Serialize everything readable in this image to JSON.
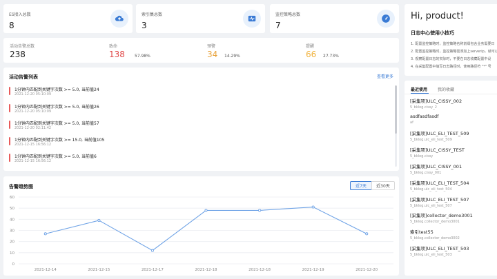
{
  "stats": [
    {
      "label": "ES接入总数",
      "value": "8",
      "icon": "upload-cloud-icon"
    },
    {
      "label": "索引集总数",
      "value": "3",
      "icon": "monitor-wave-icon"
    },
    {
      "label": "监控策略总数",
      "value": "7",
      "icon": "gauge-icon"
    }
  ],
  "summary": {
    "total_label": "活动告警总数",
    "total_value": "238",
    "fatal_label": "致命",
    "fatal_value": "138",
    "fatal_pct": "57.98%",
    "fatal_color": "#e04848",
    "warn_label": "预警",
    "warn_value": "34",
    "warn_pct": "14.29%",
    "warn_color": "#e8a23a",
    "remind_label": "提醒",
    "remind_value": "66",
    "remind_pct": "27.73%",
    "remind_color": "#f0b23c"
  },
  "alarms": {
    "title": "活动告警列表",
    "more": "查看更多",
    "items": [
      {
        "text": "1分钟内匹配到关键字次数 >= 5.0, 当前值24",
        "time": "2021-12-20 05:10:09"
      },
      {
        "text": "1分钟内匹配到关键字次数 >= 5.0, 当前值26",
        "time": "2021-12-20 05:10:09"
      },
      {
        "text": "1分钟内匹配到关键字次数 >= 5.0, 当前值57",
        "time": "2021-12-20 02:11:42"
      },
      {
        "text": "1分钟内匹配到关键字次数 >= 15.0, 当前值105",
        "time": "2021-12-15 16:56:12"
      },
      {
        "text": "1分钟内匹配到关键字次数 >= 5.0, 当前值6",
        "time": "2021-12-15 16:56:12"
      }
    ]
  },
  "trend": {
    "title": "告警趋势图",
    "btn7": "近7天",
    "btn30": "近30天"
  },
  "chart_data": {
    "type": "line",
    "categories": [
      "2021-12-14",
      "2021-12-15",
      "2021-12-17",
      "2021-12-18",
      "2021-12-18",
      "2021-12-19",
      "2021-12-20"
    ],
    "values": [
      27,
      39,
      12,
      48,
      48,
      51,
      27
    ],
    "ylim": [
      0,
      60
    ],
    "yticks": [
      "0",
      "10",
      "20",
      "30",
      "40",
      "50",
      "60"
    ],
    "line_color": "#6fa3e6",
    "grid": true
  },
  "right": {
    "greeting": "Hi, product!",
    "tips_title": "日志中心使用小技巧",
    "tips": [
      "1. 配置监控策略时，监控策略名称前缀包含业务需要日",
      "2. 配置监控策略时，监控策略需添加上serverip，就可以",
      "3. 观察配置日志的实际时，不要在日志收藏配置中设",
      "4. 在采集配置中填写日志路径时，使用路径符 \"*\" 号"
    ],
    "tab_recent": "最近使用",
    "tab_fav": "我的收藏",
    "items": [
      {
        "name": "[采集项]ULC_CISSY_002",
        "sub": "5_bklog.cissy_2"
      },
      {
        "name": "asdfasdfasdf",
        "sub": "af"
      },
      {
        "name": "[采集项]ULC_ELI_TEST_509",
        "sub": "5_bklog.ulc_eli_test_509"
      },
      {
        "name": "[采集项]ULC_CISSY_TEST",
        "sub": "5_bklog.cissy"
      },
      {
        "name": "[采集项]ULC_CISSY_001",
        "sub": "5_bklog.cissy_001"
      },
      {
        "name": "[采集项]ULC_ELI_TEST_504",
        "sub": "5_bklog.ulc_eli_test_504"
      },
      {
        "name": "[采集项]ULC_ELI_TEST_507",
        "sub": "5_bklog.ulc_eli_test_507"
      },
      {
        "name": "[采集项]collector_demo3001",
        "sub": "5_bklog.collector_demo3001"
      },
      {
        "name": "索引test55",
        "sub": "5_bklog.collector_demo3002"
      },
      {
        "name": "[采集项]ULC_ELI_TEST_503",
        "sub": "5_bklog.ulc_eli_test_503"
      }
    ]
  }
}
